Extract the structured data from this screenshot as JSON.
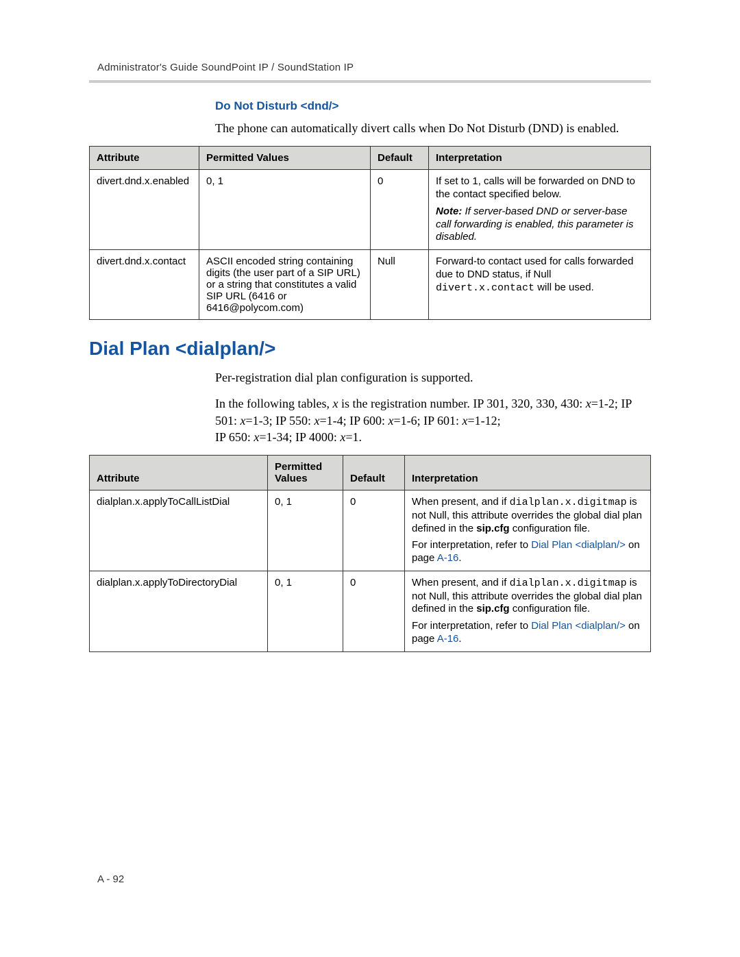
{
  "running_head": "Administrator's Guide SoundPoint IP / SoundStation IP",
  "page_number": "A - 92",
  "dnd": {
    "heading": "Do Not Disturb <dnd/>",
    "intro": "The phone can automatically divert calls when Do Not Disturb (DND) is enabled.",
    "columns": {
      "attr": "Attribute",
      "vals": "Permitted Values",
      "def": "Default",
      "interp": "Interpretation"
    },
    "rows": [
      {
        "attr": "divert.dnd.x.enabled",
        "vals": "0, 1",
        "def": "0",
        "interp_p1": "If set to 1, calls will be forwarded on DND to the contact specified below.",
        "interp_note_label": "Note:",
        "interp_note": " If server-based DND or server-base call forwarding is enabled, this parameter is disabled."
      },
      {
        "attr": "divert.dnd.x.contact",
        "vals": "ASCII encoded string containing digits (the user part of a SIP URL) or a string that constitutes a valid SIP URL (6416 or 6416@polycom.com)",
        "def": "Null",
        "interp_pre": "Forward-to contact used for calls forwarded due to DND status, if Null ",
        "interp_code": "divert.x.contact",
        "interp_post": " will be used."
      }
    ]
  },
  "dialplan": {
    "heading": "Dial Plan <dialplan/>",
    "intro": "Per-registration dial plan configuration is supported.",
    "note_pre": "In the following tables, ",
    "note_var": "x",
    "note_mid": " is the registration number. IP 301, 320, 330, 430: ",
    "note_seg1": "=1-2; IP 501: ",
    "note_seg2": "=1-3; IP 550: ",
    "note_seg3": "=1-4; IP 600: ",
    "note_seg4": "=1-6; IP 601: ",
    "note_seg5": "=1-12;",
    "note_line2_pre": "IP 650: ",
    "note_line2_seg1": "=1-34; IP 4000: ",
    "note_line2_seg2": "=1.",
    "columns": {
      "attr": "Attribute",
      "vals": "Permitted Values",
      "def": "Default",
      "interp": "Interpretation"
    },
    "interp_common": {
      "p1_pre": "When present, and if ",
      "p1_code": "dialplan.x.digitmap",
      "p1_mid": " is not Null, this attribute overrides the global dial plan defined in the ",
      "p1_bold": "sip.cfg",
      "p1_post": " configuration file.",
      "p2_pre": "For interpretation, refer to ",
      "p2_link": "Dial Plan <dialplan/>",
      "p2_mid": " on page ",
      "p2_page": "A-16",
      "p2_post": "."
    },
    "rows": [
      {
        "attr": "dialplan.x.applyToCallListDial",
        "vals": "0, 1",
        "def": "0"
      },
      {
        "attr": "dialplan.x.applyToDirectoryDial",
        "vals": "0, 1",
        "def": "0"
      }
    ]
  }
}
